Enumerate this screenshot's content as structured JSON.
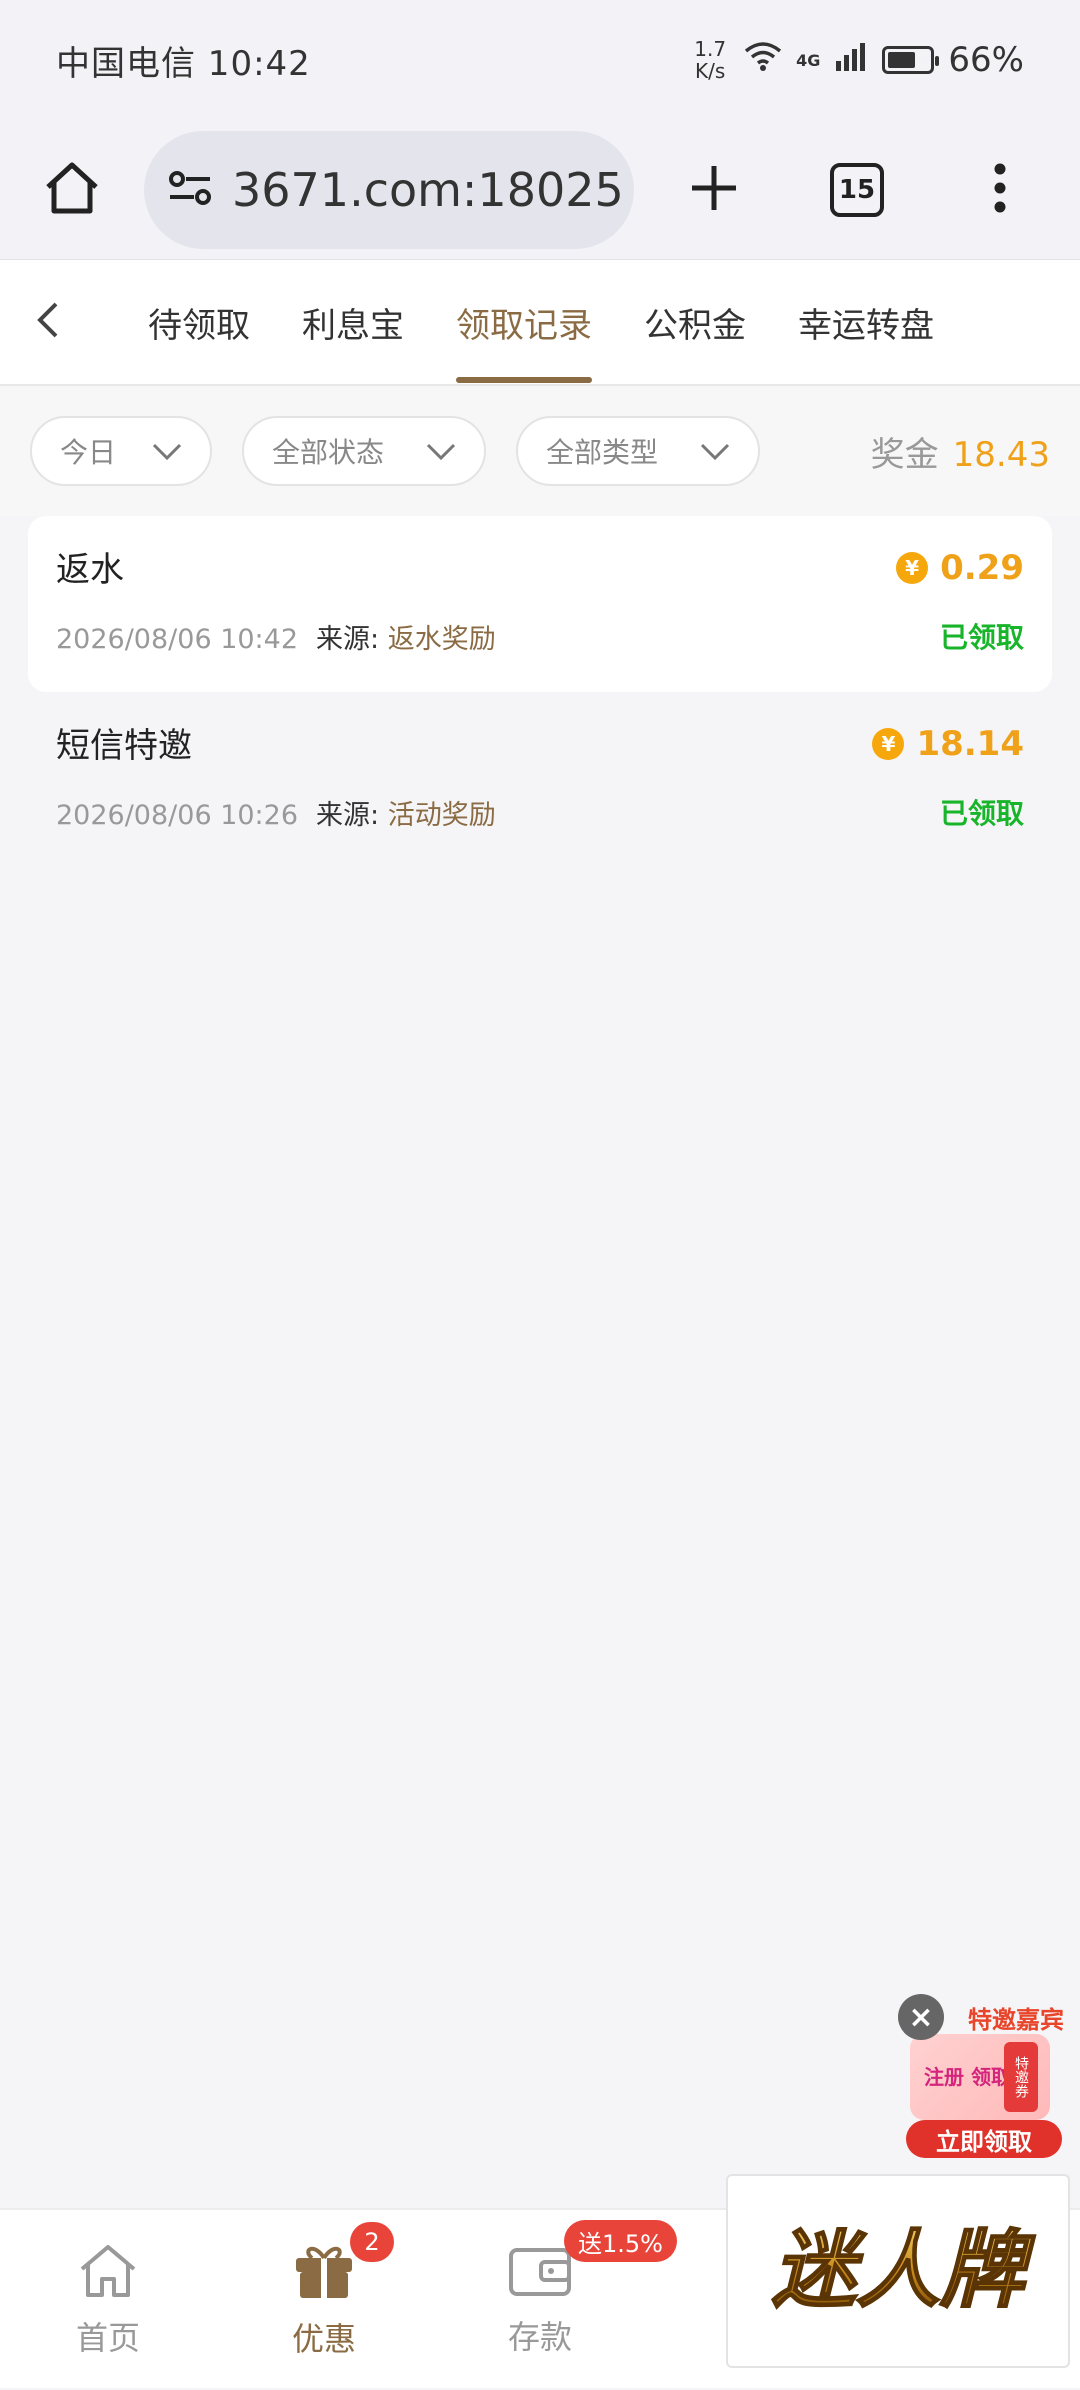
{
  "status_bar": {
    "carrier_time": "中国电信 10:42",
    "net_speed_value": "1.7",
    "net_speed_unit": "K/s",
    "network": "4G",
    "battery": "66%"
  },
  "browser": {
    "url": "3671.com:18025",
    "tab_count": "15"
  },
  "tabs": [
    {
      "label": "待领取"
    },
    {
      "label": "利息宝"
    },
    {
      "label": "领取记录",
      "active": true
    },
    {
      "label": "公积金"
    },
    {
      "label": "幸运转盘"
    }
  ],
  "filters": {
    "date": "今日",
    "status": "全部状态",
    "type": "全部类型"
  },
  "bonus": {
    "label": "奖金",
    "value": "18.43"
  },
  "records": [
    {
      "title": "返水",
      "datetime": "2026/08/06 10:42",
      "source_label": "来源:",
      "source": "返水奖励",
      "amount": "0.29",
      "status": "已领取"
    },
    {
      "title": "短信特邀",
      "datetime": "2026/08/06 10:26",
      "source_label": "来源:",
      "source": "活动奖励",
      "amount": "18.14",
      "status": "已领取"
    }
  ],
  "promo": {
    "close": "×",
    "headline": "特邀嘉宾",
    "left_text": "注册 领取",
    "right_text": "特邀券",
    "cta": "立即领取"
  },
  "bottom_nav": [
    {
      "label": "首页",
      "icon": "home-icon"
    },
    {
      "label": "优惠",
      "icon": "gift-icon",
      "badge": "2"
    },
    {
      "label": "存款",
      "icon": "wallet-icon",
      "tag": "送1.5%"
    }
  ],
  "logo_text": "迷人牌",
  "colors": {
    "brand": "#8a6b43",
    "amount": "#f0a11a",
    "success": "#18b52a",
    "badge": "#e8443a"
  }
}
